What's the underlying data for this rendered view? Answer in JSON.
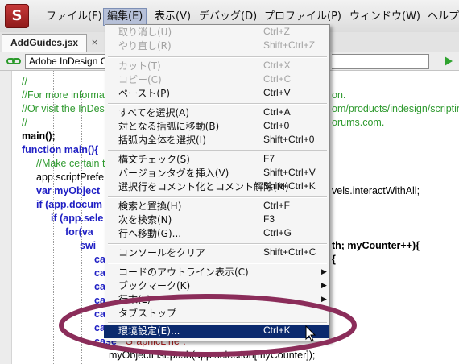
{
  "menubar": {
    "items": [
      "ファイル(F)",
      "編集(E)",
      "表示(V)",
      "デバッグ(D)",
      "プロファイル(P)",
      "ウィンドウ(W)",
      "ヘルプ"
    ],
    "active_index": 1
  },
  "tab": {
    "label": "AddGuides.jsx",
    "close": "×"
  },
  "toolbar": {
    "target": "Adobe InDesign C"
  },
  "code": [
    "//",
    "//For more informa",
    "//Or visit the InDesi",
    "//",
    "main();",
    "function main(){",
    "//Make certain t",
    "app.scriptPrefe",
    "var myObject",
    "if (app.docum",
    "if (app.sele",
    "for(va",
    "swi",
    "ca",
    "ca",
    "ca",
    "ca",
    "ca",
    "ca",
    "case",
    "\"GraphicLine\":",
    "myObjectList.push(app.selection[myCounter]);"
  ],
  "code_right": [
    "on.",
    "om/products/indesign/scripting",
    "orums.com.",
    "vels.interactWithAll;",
    "th; myCounter++){",
    "{"
  ],
  "edit_menu": [
    {
      "label": "取り消し(U)",
      "shortcut": "Ctrl+Z",
      "disabled": true
    },
    {
      "label": "やり直し(R)",
      "shortcut": "Shift+Ctrl+Z",
      "disabled": true
    },
    {
      "label": "カット(T)",
      "shortcut": "Ctrl+X",
      "disabled": true
    },
    {
      "label": "コピー(C)",
      "shortcut": "Ctrl+C",
      "disabled": true
    },
    {
      "label": "ペースト(P)",
      "shortcut": "Ctrl+V",
      "disabled": false
    },
    {
      "label": "すべてを選択(A)",
      "shortcut": "Ctrl+A",
      "disabled": false
    },
    {
      "label": "対となる括弧に移動(B)",
      "shortcut": "Ctrl+0",
      "disabled": false
    },
    {
      "label": "括弧内全体を選択(I)",
      "shortcut": "Shift+Ctrl+0",
      "disabled": false
    },
    {
      "label": "構文チェック(S)",
      "shortcut": "F7",
      "disabled": false
    },
    {
      "label": "バージョンタグを挿入(V)",
      "shortcut": "Shift+Ctrl+V",
      "disabled": false
    },
    {
      "label": "選択行をコメント化とコメント解除(M)",
      "shortcut": "Shift+Ctrl+K",
      "disabled": false
    },
    {
      "label": "検索と置換(H)",
      "shortcut": "Ctrl+F",
      "disabled": false
    },
    {
      "label": "次を検索(N)",
      "shortcut": "F3",
      "disabled": false
    },
    {
      "label": "行へ移動(G)...",
      "shortcut": "Ctrl+G",
      "disabled": false
    },
    {
      "label": "コンソールをクリア",
      "shortcut": "Shift+Ctrl+C",
      "disabled": false
    },
    {
      "label": "コードのアウトライン表示(C)",
      "shortcut": "",
      "disabled": false
    },
    {
      "label": "ブックマーク(K)",
      "shortcut": "",
      "disabled": false
    },
    {
      "label": "行末(L)",
      "shortcut": "",
      "disabled": false
    },
    {
      "label": "タブストップ",
      "shortcut": "",
      "disabled": false
    },
    {
      "label": "環境設定(E)...",
      "shortcut": "Ctrl+K",
      "disabled": false,
      "highlighted": true
    }
  ],
  "colors": {
    "highlight": "#0b2a6e",
    "annotation_ellipse": "#8b2d5a",
    "comment": "#2f9a2f",
    "keyword": "#1f1fc4",
    "string": "#b12222"
  }
}
